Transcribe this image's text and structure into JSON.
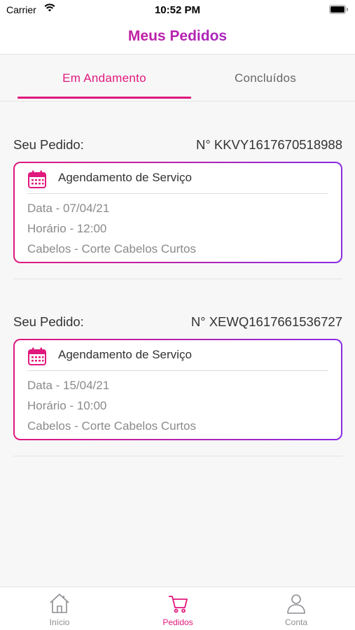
{
  "status_bar": {
    "carrier": "Carrier",
    "time": "10:52 PM"
  },
  "header": {
    "title": "Meus Pedidos"
  },
  "tabs": {
    "active": "Em Andamento",
    "inactive": "Concluídos"
  },
  "orders": [
    {
      "label": "Seu Pedido:",
      "number": "N° KKVY1617670518988",
      "card_title": "Agendamento de Serviço",
      "date": "Data - 07/04/21",
      "time": "Horário - 12:00",
      "service": "Cabelos - Corte Cabelos Curtos"
    },
    {
      "label": "Seu Pedido:",
      "number": "N° XEWQ1617661536727",
      "card_title": "Agendamento de Serviço",
      "date": "Data - 15/04/21",
      "time": "Horário - 10:00",
      "service": "Cabelos - Corte Cabelos Curtos"
    }
  ],
  "tabbar": {
    "items": [
      {
        "label": "Início",
        "icon": "home-icon"
      },
      {
        "label": "Pedidos",
        "icon": "cart-icon"
      },
      {
        "label": "Conta",
        "icon": "user-icon"
      }
    ]
  },
  "colors": {
    "accent": "#e0197d",
    "accent_secondary": "#8a2be2",
    "inactive": "#8e8e93"
  }
}
